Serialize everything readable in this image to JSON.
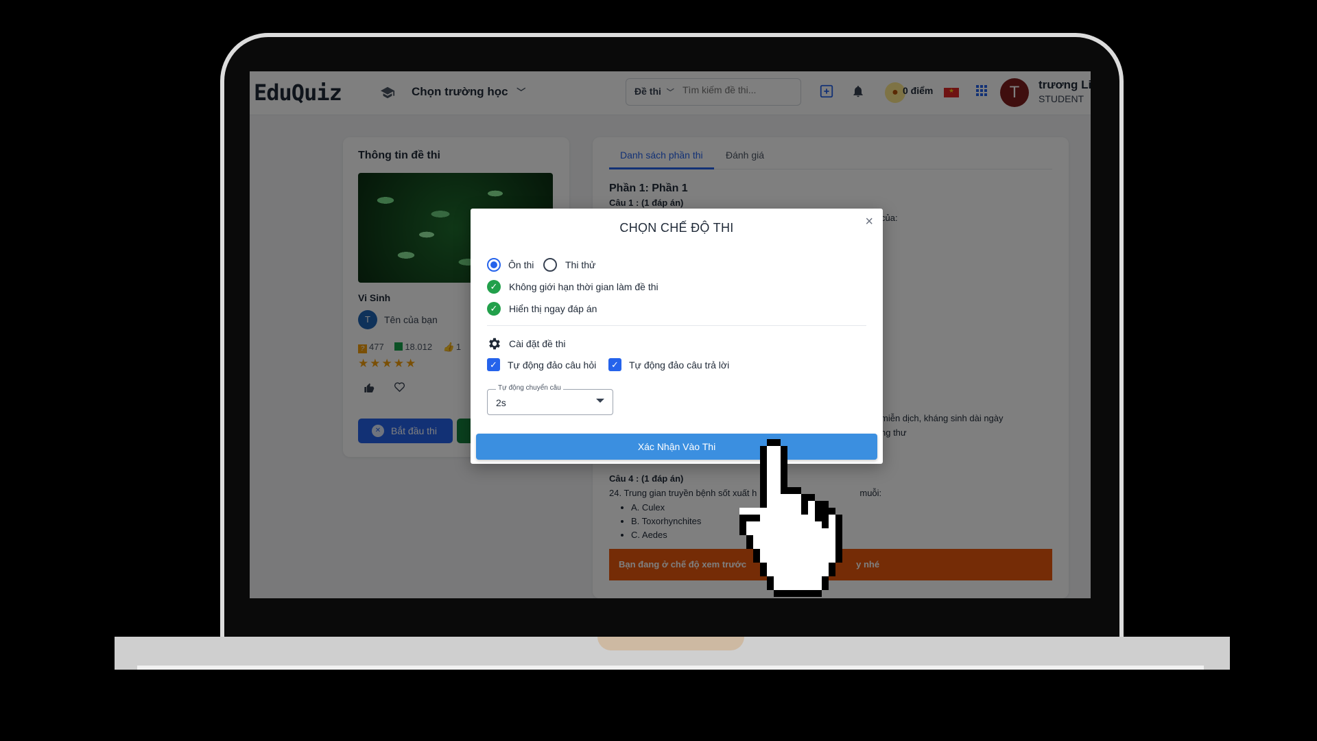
{
  "header": {
    "logo": "EduQuiz",
    "school_select": "Chọn trường học",
    "search": {
      "type": "Đề thi",
      "placeholder": "Tìm kiếm đề thi..."
    },
    "points": "0 điểm",
    "user": {
      "initial": "T",
      "name": "trương Li",
      "role": "STUDENT"
    }
  },
  "exam_info": {
    "title": "Thông tin đề thi",
    "subject": "Vi Sinh",
    "author_initial": "T",
    "author_name": "Tên của bạn",
    "stats": {
      "questions": "477",
      "views": "18.012",
      "likes": "1"
    },
    "stars": "★★★★★",
    "start_button": "Bắt đầu thi"
  },
  "content": {
    "tabs": [
      "Danh sách phần thi",
      "Đánh giá"
    ],
    "part_title": "Phần 1: Phần 1",
    "q1_title": "Câu 1 : (1 đáp án)",
    "partial_text": [
      "của:",
      ":",
      "miễn dịch, kháng sinh dài ngày",
      "ng thư"
    ],
    "q4": {
      "title": "Câu 4 : (1 đáp án)",
      "text": "24. Trung gian truyền bệnh sốt xuất h",
      "text_end": "muỗi:",
      "options": [
        "A. Culex",
        "B. Toxorhynchites",
        "C. Aedes"
      ]
    },
    "banner": "Bạn đang ở chế độ xem trước",
    "banner_end": "y nhé"
  },
  "modal": {
    "title": "CHỌN CHẾ ĐỘ THI",
    "close": "×",
    "modes": [
      {
        "label": "Ôn thi",
        "checked": true
      },
      {
        "label": "Thi thử",
        "checked": false
      }
    ],
    "features": [
      "Không giới hạn thời gian làm đề thi",
      "Hiển thị ngay đáp án"
    ],
    "settings_label": "Cài đặt đề thi",
    "checkboxes": [
      "Tự động đảo câu hỏi",
      "Tự động đảo câu trả lời"
    ],
    "auto_next": {
      "label": "Tự động chuyển câu",
      "value": "2s"
    },
    "confirm": "Xác Nhận Vào Thi"
  },
  "icons": [
    "school-icon",
    "chevron-down-icon",
    "add-exam-icon",
    "bell-icon",
    "coin-icon",
    "flag-icon",
    "apps-grid-icon",
    "gear-icon",
    "close-icon",
    "pointer-hand-icon"
  ]
}
